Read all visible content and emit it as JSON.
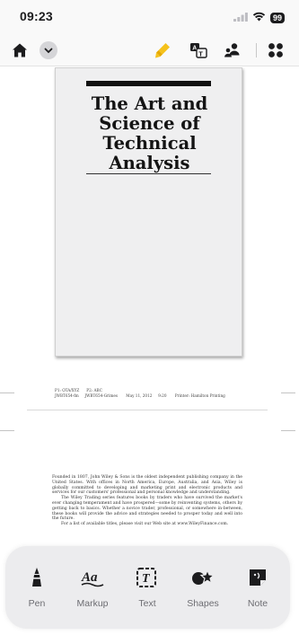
{
  "status_bar": {
    "time": "09:23",
    "battery": "99",
    "icons": [
      "signal-icon",
      "wifi-icon",
      "battery-icon"
    ]
  },
  "toolbar": {
    "left": [
      "home-icon",
      "chevron-down-icon"
    ],
    "right": [
      "highlighter-icon",
      "translate-icon",
      "account-icon",
      "grid-icon"
    ],
    "accent_color": "#f5c21b"
  },
  "document": {
    "cover": {
      "title": "The Art and Science of Technical Analysis"
    },
    "slug": {
      "line1": "P1: OTA/XYZ      P2: ABC",
      "line2": "JWBT654-fm     JWBT654-Grimes       May 11, 2012     9:20       Printer: Hamilton Printing"
    },
    "copyright": {
      "p1": "Founded in 1807, John Wiley & Sons is the oldest independent publishing company in the United States. With offices in North America, Europe, Australia, and Asia, Wiley is globally committed to developing and marketing print and electronic products and services for our customers' professional and personal knowledge and understanding.",
      "p2": "The Wiley Trading series features books by traders who have survived the market's ever changing temperament and have prospered—some by reinventing systems, others by getting back to basics. Whether a novice trader, professional, or somewhere in-between, these books will provide the advice and strategies needed to prosper today and well into the future.",
      "p3": "For a list of available titles, please visit our Web site at www.WileyFinance.com."
    }
  },
  "tools": [
    {
      "label": "Pen",
      "icon": "pen-icon"
    },
    {
      "label": "Markup",
      "icon": "markup-icon"
    },
    {
      "label": "Text",
      "icon": "text-icon"
    },
    {
      "label": "Shapes",
      "icon": "shapes-icon"
    },
    {
      "label": "Note",
      "icon": "note-icon"
    }
  ]
}
